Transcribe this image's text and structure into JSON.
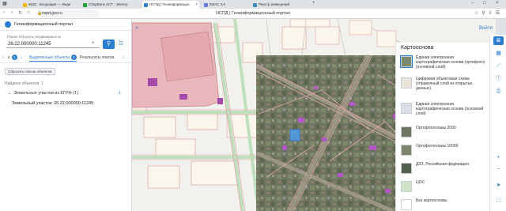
{
  "browser": {
    "tabs": [
      {
        "label": "5632 - Входящие — Янде",
        "color": "#f4b400"
      },
      {
        "label": "СберБанк АСТ - Электр",
        "color": "#21a038"
      },
      {
        "label": "НСПД | Геоинформацио",
        "color": "#2b7dd1",
        "active": true
      },
      {
        "label": "ЕИАС 3.0",
        "color": "#6a7bd6"
      },
      {
        "label": "Реестр извещений",
        "color": "#3c8dbc"
      }
    ],
    "url": "nspd.gov.ru",
    "page_title": "НСПД | Геоинформационный портал"
  },
  "panel": {
    "portal_title": "Геоинформационный портал",
    "search_label": "Поиск Объекты недвижимости",
    "search_value": "26:22:000000:11245",
    "tabs": {
      "selected_label": "Выделенные объекты",
      "selected_count": "1",
      "results_label": "Результаты поиска",
      "results_count": "1"
    },
    "reset_label": "Сбросить список объектов",
    "found_text": "Найдено объектов: 1",
    "group_label": "Земельные участки из ЕГРН (1)",
    "result_label": "Земельный участок: 26:22:000000:11245"
  },
  "map": {
    "login_label": "Войти",
    "basemap": {
      "title": "Картооснова",
      "items": [
        {
          "label": "Единая электронная картографическая основа (ортофото)(основной слой)",
          "thumb": "#7a8a6a"
        },
        {
          "label": "Цифровая объектовая схема (справочный слой из открытых данных)",
          "thumb": "#e9e3da"
        },
        {
          "label": "Единая электронная картографическая основа (основной слой)",
          "thumb": "#d9dfe4"
        },
        {
          "label": "Ортофотопланы 2000",
          "thumb": "#6d7563"
        },
        {
          "label": "Ортофотопланы 10000",
          "thumb": "#7c8670"
        },
        {
          "label": "ДЗЗ, Российская федерация",
          "thumb": "#55604c"
        },
        {
          "label": "ЦОС",
          "thumb": "#cfe3c9"
        },
        {
          "label": "Без картоосновы",
          "thumb": "#ffffff"
        }
      ]
    }
  }
}
